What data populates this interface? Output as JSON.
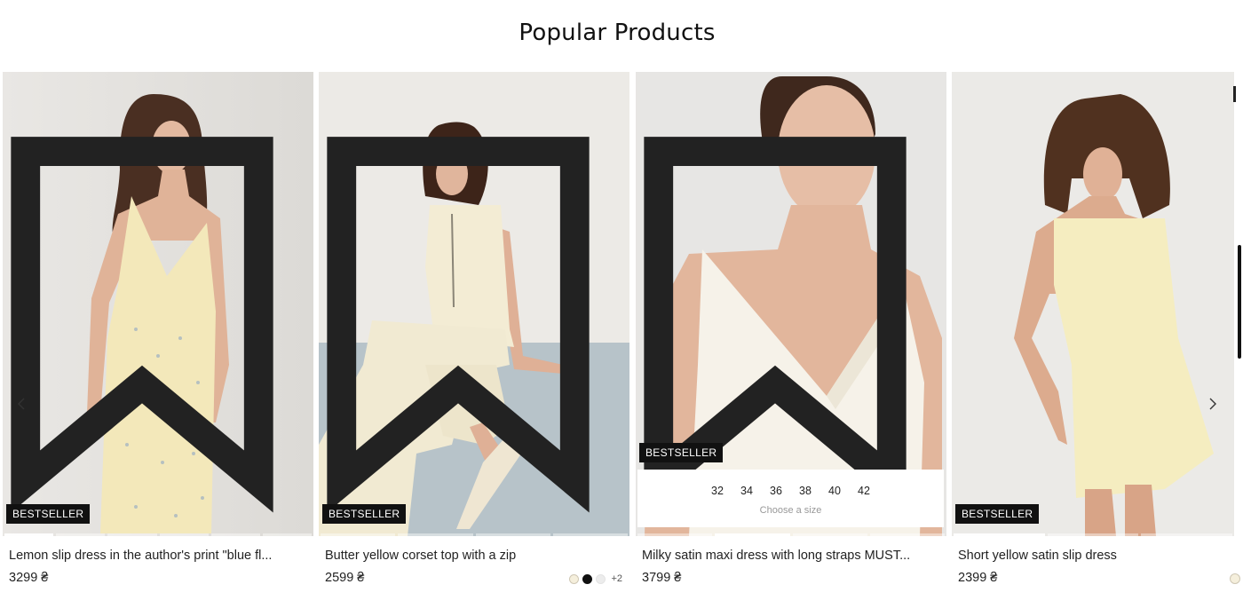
{
  "section": {
    "title": "Popular Products"
  },
  "carousel": {
    "prev_icon": "chevron-left-icon",
    "next_icon": "chevron-right-icon"
  },
  "products": [
    {
      "name": "Lemon slip dress in the author's print \"blue fl...",
      "price": "3299 ₴",
      "badge": "BESTSELLER",
      "image": "model in lemon floral slip dress",
      "colors": {
        "dress": "#f4e9bd",
        "bg": "#e4e2df"
      }
    },
    {
      "name": "Butter yellow corset top with a zip",
      "price": "2599 ₴",
      "badge": "BESTSELLER",
      "image": "model in butter yellow corset top and trousers",
      "swatches": [
        "cream",
        "black",
        "white"
      ],
      "swatches_more": "+2"
    },
    {
      "name": "Milky satin maxi dress with long straps MUST...",
      "price": "3799 ₴",
      "badge": "BESTSELLER",
      "image": "model in milky satin dress close-up",
      "sizes": [
        "32",
        "34",
        "36",
        "38",
        "40",
        "42"
      ],
      "size_hint": "Choose a size"
    },
    {
      "name": "Short yellow satin slip dress",
      "price": "2399 ₴",
      "badge": "BESTSELLER",
      "image": "model in short yellow satin slip dress"
    }
  ]
}
